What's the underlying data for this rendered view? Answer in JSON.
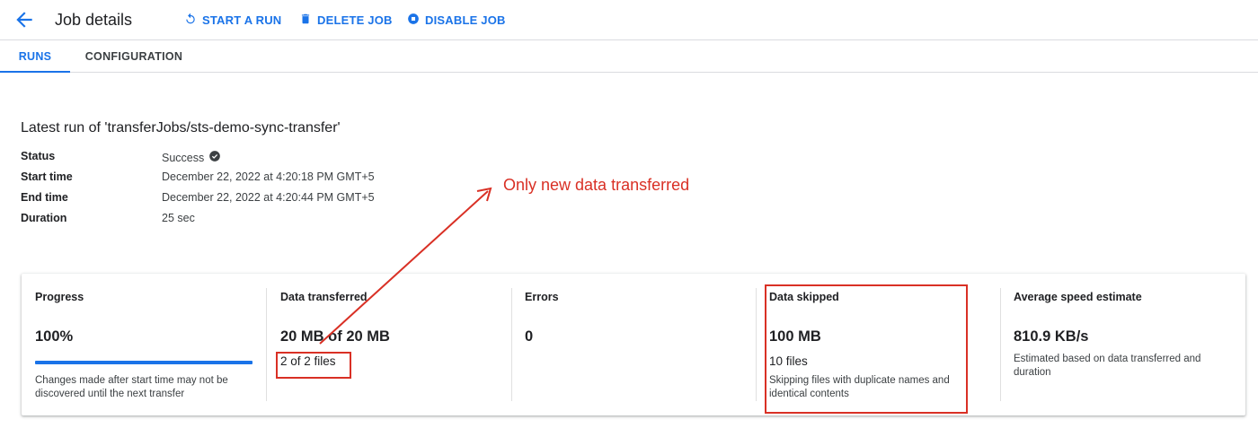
{
  "header": {
    "title": "Job details",
    "actions": {
      "start_run": "START A RUN",
      "delete_job": "DELETE JOB",
      "disable_job": "DISABLE JOB"
    }
  },
  "tabs": {
    "runs": "RUNS",
    "configuration": "CONFIGURATION",
    "active": "RUNS"
  },
  "latest_run": {
    "heading": "Latest run of 'transferJobs/sts-demo-sync-transfer'",
    "rows": [
      {
        "label": "Status",
        "value": "Success"
      },
      {
        "label": "Start time",
        "value": "December 22, 2022 at 4:20:18 PM GMT+5"
      },
      {
        "label": "End time",
        "value": "December 22, 2022 at 4:20:44 PM GMT+5"
      },
      {
        "label": "Duration",
        "value": "25 sec"
      }
    ]
  },
  "stats": {
    "progress": {
      "title": "Progress",
      "value": "100%",
      "fraction": 1.0,
      "note": "Changes made after start time may not be discovered until the next transfer"
    },
    "data_transferred": {
      "title": "Data transferred",
      "value": "20 MB of 20 MB",
      "files": "2 of 2 files"
    },
    "errors": {
      "title": "Errors",
      "value": "0"
    },
    "data_skipped": {
      "title": "Data skipped",
      "value": "100 MB",
      "files": "10 files",
      "note": "Skipping files with duplicate names and identical contents"
    },
    "speed": {
      "title": "Average speed estimate",
      "value": "810.9 KB/s",
      "note": "Estimated based on data transferred and duration"
    }
  },
  "annotation": {
    "text": "Only new data transferred",
    "color": "#d93025"
  },
  "colors": {
    "accent": "#1a73e8",
    "annotation": "#d93025"
  }
}
